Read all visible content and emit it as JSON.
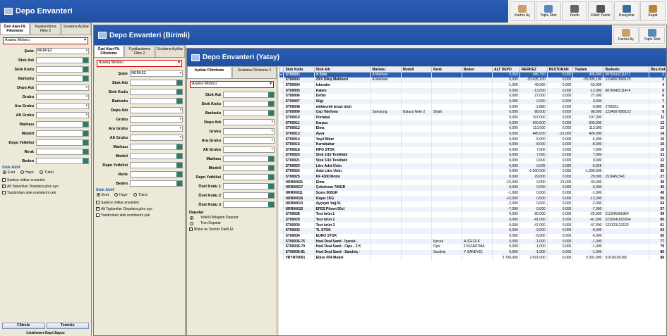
{
  "win1": {
    "title": "Depo Envanteri",
    "toolbar": [
      {
        "label": "Kartını Aç",
        "icon": "card-icon",
        "color": "#c9a06a"
      },
      {
        "label": "Toplu Stok",
        "icon": "stock-icon",
        "color": "#5d86b9"
      },
      {
        "label": "Yazdır",
        "icon": "printer-icon",
        "color": "#666666"
      },
      {
        "label": "Etiket Yazdır",
        "icon": "label-printer-icon",
        "color": "#555555"
      },
      {
        "label": "Kısayollar",
        "icon": "shortcut-icon",
        "color": "#3b6e9e"
      },
      {
        "label": "Kapat",
        "icon": "door-icon",
        "color": "#b9873a"
      }
    ],
    "tabs": [
      "Özel Alan Flt. Filtreleme",
      "Fiyatlandırma Filtre 2",
      "Sıralama Açıklar"
    ],
    "search": "Arama Motoru",
    "fields": [
      {
        "label": "Şube",
        "value": "MERKEZ"
      },
      {
        "label": "Stok Adı",
        "value": ""
      },
      {
        "label": "Stok Kodu",
        "value": ""
      },
      {
        "label": "Barkodu",
        "value": ""
      },
      {
        "label": "Depo Adı",
        "value": ""
      },
      {
        "label": "Grubu",
        "value": ""
      },
      {
        "label": "Ara Grubu",
        "value": ""
      },
      {
        "label": "Alt Grubu",
        "value": ""
      },
      {
        "label": "Markası",
        "value": ""
      },
      {
        "label": "Modeli",
        "value": ""
      },
      {
        "label": "Depo Yetkilisi",
        "value": ""
      },
      {
        "label": "Renk",
        "value": ""
      },
      {
        "label": "Beden",
        "value": ""
      }
    ],
    "stok_aktif": "Stok Aktif",
    "radio": [
      "Evet",
      "Hayır",
      "Tümü"
    ],
    "checks": [
      "Sadece miktar envanteri",
      "Alt Toplamları Depolara göre ayır",
      "Yazdırırken stok resimlerini çek"
    ],
    "filter_btn": "Filtrele",
    "clear_btn": "Temizle",
    "footer": "Listelenen Kayıt Sayısı"
  },
  "win2": {
    "title": "Depo Envanteri (Birimli)",
    "toolbar": [
      {
        "label": "Kartını Aç",
        "icon": "card-icon",
        "color": "#c9a06a"
      },
      {
        "label": "Toplu Stok",
        "icon": "stock-icon",
        "color": "#5d86b9"
      }
    ],
    "tabs": [
      "Özel Alan Flt. Filtreleme",
      "Fiyatlandırma Filtre 2",
      "Sıralama Açıklar"
    ],
    "search": "Arama Motoru",
    "fields": [
      {
        "label": "Şube",
        "value": "MERKEZ"
      },
      {
        "label": "Stok Adı",
        "value": ""
      },
      {
        "label": "Stok Kodu",
        "value": ""
      },
      {
        "label": "Barkodu",
        "value": ""
      },
      {
        "label": "Depo Adı",
        "value": ""
      },
      {
        "label": "Grubu",
        "value": ""
      },
      {
        "label": "Ara Grubu",
        "value": ""
      },
      {
        "label": "Alt Grubu",
        "value": ""
      },
      {
        "label": "Markası",
        "value": ""
      },
      {
        "label": "Modeli",
        "value": ""
      },
      {
        "label": "Depo Yetkilisi",
        "value": ""
      },
      {
        "label": "Renk",
        "value": ""
      },
      {
        "label": "Beden",
        "value": ""
      }
    ],
    "stok_aktif": "Stok Aktif",
    "radio": [
      "Evet",
      "Hayır",
      "Tümü"
    ],
    "checks": [
      "Sadece miktar envanteri",
      "Alt Toplamları Depolara göre ayır",
      "Yazdırırken stok resimlerini çek"
    ]
  },
  "win3": {
    "title": "Depo Envanteri (Yatay)",
    "tabs": [
      "Açıklar Filtreleme",
      "Sıralama Filtreleme 2"
    ],
    "search": "Arama Motoru",
    "fields": [
      {
        "label": "Stok Adı"
      },
      {
        "label": "Stok Kodu"
      },
      {
        "label": "Barkodu"
      },
      {
        "label": "Depo Adı"
      },
      {
        "label": "Grubu"
      },
      {
        "label": "Ara Grubu"
      },
      {
        "label": "Alt Grubu"
      },
      {
        "label": "Markası"
      },
      {
        "label": "Modeli"
      },
      {
        "label": "Depo Yetkilisi"
      },
      {
        "label": "Özel Kodu 1"
      },
      {
        "label": "Özel Kodu 2"
      },
      {
        "label": "Özel Kodu 3"
      }
    ],
    "depolar": "Depolar",
    "radio": [
      "Yetkili Olduğum Depolar",
      "Tüm Depolar"
    ],
    "check": "Bloke ve Termini Dahil Et",
    "columns": [
      "Stok Kodu",
      "Stok Adı",
      "Markası",
      "Modeli",
      "Renk",
      "Beden",
      "ALT DEPO",
      "MERKEZ",
      "RESTORAN",
      "Toplam",
      "Barkodu",
      "Bkş.Kodu"
    ],
    "rows": [
      [
        "ST00001",
        "X Stok",
        "A Markası",
        "",
        "",
        "",
        "0,050",
        "486,750",
        "0,000",
        "486,800",
        "9876543211472",
        "1"
      ],
      [
        "ST00003",
        "ZXX Dikiş Makinesi",
        "A Markası",
        "",
        "",
        "",
        "0,000",
        "-20.005,100",
        "0,000",
        "-20.005,100",
        "1234567890125",
        "3"
      ],
      [
        "ST00004",
        "İskender",
        "",
        "",
        "",
        "",
        "-1,000",
        "-49,000",
        "0,000",
        "-50,000",
        "",
        "4"
      ],
      [
        "ST00005",
        "Kalem",
        "",
        "",
        "",
        "",
        "0,000",
        "-13,000",
        "0,000",
        "-13,000",
        "9876543211474",
        "5"
      ],
      [
        "ST00006",
        "Defter",
        "",
        "",
        "",
        "",
        "0,000",
        "27,000",
        "0,000",
        "27,000",
        "",
        "6"
      ],
      [
        "ST00007",
        "Silgi",
        "",
        "",
        "",
        "",
        "0,000",
        "0,000",
        "0,000",
        "0,000",
        "",
        "7"
      ],
      [
        "ST00008",
        "elektronik terazi ürün",
        "",
        "",
        "",
        "",
        "0,000",
        "-2,880",
        "0,000",
        "-0,880",
        "2700011",
        "8"
      ],
      [
        "ST00009",
        "Cep Telefonu",
        "Samsung",
        "Galaxy Note 2",
        "Siyah",
        "",
        "0,000",
        "88,000",
        "0,000",
        "88,000",
        "1234567890123",
        "9"
      ],
      [
        "ST00010",
        "Portakal",
        "",
        "",
        "",
        "",
        "0,000",
        "197,000",
        "0,000",
        "197,000",
        "",
        "11"
      ],
      [
        "ST00011",
        "Karpuz",
        "",
        "",
        "",
        "",
        "0,000",
        "600,000",
        "0,000",
        "600,000",
        "",
        "12"
      ],
      [
        "ST00012",
        "Elma",
        "",
        "",
        "",
        "",
        "0,000",
        "113,000",
        "0,000",
        "113,000",
        "",
        "13"
      ],
      [
        "ST00013",
        "Ayva",
        "",
        "",
        "",
        "",
        "0,000",
        "445,000",
        "-21,000",
        "424,000",
        "",
        "14"
      ],
      [
        "ST00014",
        "Yeşil Biber",
        "",
        "",
        "",
        "",
        "0,000",
        "-5,000",
        "0,000",
        "-5,000",
        "",
        "15"
      ],
      [
        "ST00015",
        "Karnıbahar",
        "",
        "",
        "",
        "",
        "0,000",
        "-8,000",
        "0,000",
        "-8,000",
        "",
        "16"
      ],
      [
        "ST00018",
        "FIFO STOK",
        "",
        "",
        "",
        "",
        "0,000",
        "7,000",
        "0,000",
        "7,000",
        "",
        "19"
      ],
      [
        "ST00020",
        "Stok 2/10 Tevkifatlı",
        "",
        "",
        "",
        "",
        "0,000",
        "7,000",
        "0,000",
        "7,000",
        "",
        "21"
      ],
      [
        "ST00021",
        "Stok 5/10 Tevkifatlı",
        "",
        "",
        "",
        "",
        "0,000",
        "0,000",
        "0,000",
        "0,000",
        "",
        "22"
      ],
      [
        "ST00023",
        "Litre Adet Ürün",
        "",
        "",
        "",
        "",
        "0,000",
        "-0,025",
        "0,000",
        "-0,025",
        "",
        "25"
      ],
      [
        "ST00024",
        "Adet Litre Ürün",
        "",
        "",
        "",
        "",
        "0,000",
        "-1.000,000",
        "0,000",
        "-1.000,000",
        "",
        "26"
      ],
      [
        "ST00025",
        "KF 4300 Motor",
        "",
        "",
        "",
        "",
        "0,000",
        "29,000",
        "0,000",
        "29,000",
        "1516451541",
        "27"
      ],
      [
        "URR00021",
        "Elma",
        "",
        "",
        "",
        "",
        "-12,000",
        "0,000",
        "-21,000",
        "-33,000",
        "",
        "38"
      ],
      [
        "URR00017",
        "Çokokrem 700GR",
        "",
        "",
        "",
        "",
        "-3,000",
        "0,000",
        "0,000",
        "-3,000",
        "",
        "45"
      ],
      [
        "URR00011",
        "Sosis 500GR",
        "",
        "",
        "",
        "",
        "-1,000",
        "0,000",
        "0,000",
        "-1,000",
        "",
        "49"
      ],
      [
        "URR00016",
        "Kaşar 1KG",
        "",
        "",
        "",
        "",
        "-13,000",
        "0,000",
        "0,000",
        "-13,000",
        "",
        "50"
      ],
      [
        "URR00013",
        "Ayçiçek Yağ 5L",
        "",
        "",
        "",
        "",
        "-2,000",
        "0,000",
        "0,000",
        "-2,000",
        "",
        "54"
      ],
      [
        "URR00015",
        "EFES Pilsen 50cl",
        "",
        "",
        "",
        "",
        "-7,000",
        "0,000",
        "0,000",
        "-7,000",
        "",
        "57"
      ],
      [
        "ST00028",
        "Test ürün 1",
        "",
        "",
        "",
        "",
        "0,000",
        "-25,000",
        "0,000",
        "-25,000",
        "212345366354",
        "59"
      ],
      [
        "ST00029",
        "Test ürün 2",
        "",
        "",
        "",
        "",
        "0,000",
        "-41,000",
        "0,000",
        "-41,000",
        "3216541651654",
        "60"
      ],
      [
        "ST00030",
        "Test ürün 3",
        "",
        "",
        "",
        "",
        "0,000",
        "-47,000",
        "0,000",
        "-47,000",
        "123123123122",
        "61"
      ],
      [
        "ST00032",
        "TL STOK",
        "",
        "",
        "",
        "",
        "0,000",
        "-9,000",
        "0,000",
        "-9,000",
        "",
        "63"
      ],
      [
        "ST00034",
        "EURO STOK",
        "",
        "",
        "",
        "",
        "0,000",
        "-6,000",
        "0,000",
        "-6,000",
        "",
        "65"
      ],
      [
        "ST00036-76",
        "Heal Deal Sand - İçecek -",
        "",
        "",
        "İçecek",
        "A İÇECEK",
        "0,000",
        "-1,000",
        "0,000",
        "-1,000",
        "",
        "77"
      ],
      [
        "ST00036-79",
        "Heal Deal Sand - Cips - Z K",
        "",
        "",
        "Cips",
        "Z KIZARTMA",
        "0,000",
        "-1,000",
        "0,000",
        "-1,000",
        "",
        "79"
      ],
      [
        "ST00036-81",
        "Heal Deal Sand - Sandviç -",
        "",
        "",
        "Sandviç",
        "Y SANDVİÇ",
        "0,000",
        "-1,000",
        "0,000",
        "-1,000",
        "",
        "80"
      ],
      [
        "VRYNT0001",
        "Ebise 054 Model",
        "",
        "",
        "",
        "",
        "2.700,000",
        "2.691,000",
        "0,000",
        "5.391,000",
        "51616165165",
        "88"
      ]
    ]
  }
}
